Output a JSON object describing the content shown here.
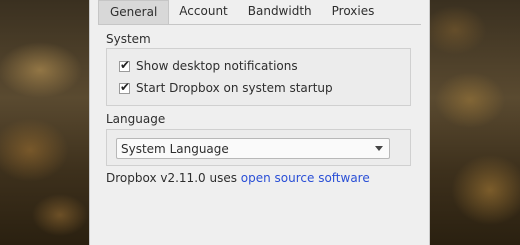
{
  "tabs": [
    {
      "label": "General",
      "active": true
    },
    {
      "label": "Account",
      "active": false
    },
    {
      "label": "Bandwidth",
      "active": false
    },
    {
      "label": "Proxies",
      "active": false
    }
  ],
  "system": {
    "heading": "System",
    "show_notifications": {
      "label": "Show desktop notifications",
      "checked": true
    },
    "start_on_startup": {
      "label": "Start Dropbox on system startup",
      "checked": true
    }
  },
  "language": {
    "heading": "Language",
    "selected": "System Language"
  },
  "footer": {
    "prefix": "Dropbox v2.11.0 uses ",
    "link": "open source software"
  },
  "colors": {
    "link": "#2a4fd6",
    "dialog_bg": "#efefef"
  }
}
